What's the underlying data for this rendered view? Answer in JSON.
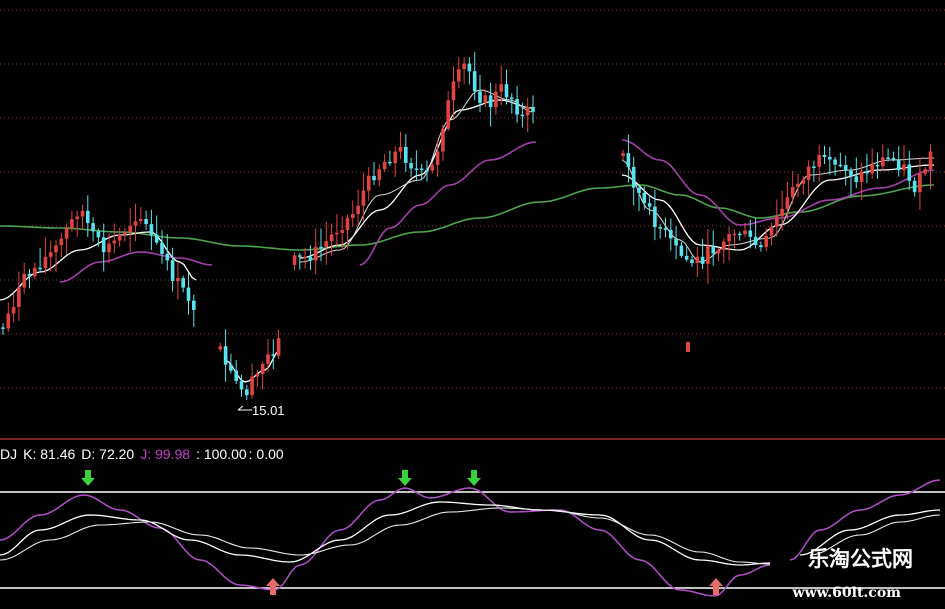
{
  "chart_data": [
    {
      "type": "candlestick",
      "panel": "price",
      "colors": {
        "up": "#e0443f",
        "down": "#59e3ee",
        "ma5": "#ffffff",
        "ma10": "#d9d9d9",
        "ma20": "#a33fa8",
        "ma60": "#4ea34e",
        "grid": "#8a3434"
      },
      "annotations": [
        {
          "label": "15.01",
          "type": "low-marker"
        }
      ],
      "note_gaps": "price panel has blank regions where candles are missing"
    },
    {
      "type": "line",
      "panel": "indicator",
      "indicator": "KDJ",
      "legend": {
        "prefix": "DJ",
        "k_label": "K: 81.46",
        "d_label": "D: 72.20",
        "j_label": "J: 99.98",
        "level_high": ": 100.00",
        "level_low": ": 0.00"
      },
      "k_value": 81.46,
      "d_value": 72.2,
      "j_value": 99.98,
      "levels": [
        100,
        0
      ],
      "signals": [
        {
          "type": "sell",
          "icon": "green-down-arrow-icon"
        },
        {
          "type": "sell",
          "icon": "green-down-arrow-icon"
        },
        {
          "type": "sell",
          "icon": "green-down-arrow-icon"
        },
        {
          "type": "buy",
          "icon": "red-up-arrow-icon"
        },
        {
          "type": "buy",
          "icon": "red-up-arrow-icon"
        }
      ],
      "colors": {
        "k": "#ffffff",
        "d": "#e8e8e8",
        "j": "#b04fc8",
        "levels": "#ffffff",
        "k_text": "#ffffff",
        "j_text": "#c042c8"
      }
    }
  ],
  "watermark": {
    "brand": "乐淘公式网",
    "url": "www.60lt.com"
  }
}
